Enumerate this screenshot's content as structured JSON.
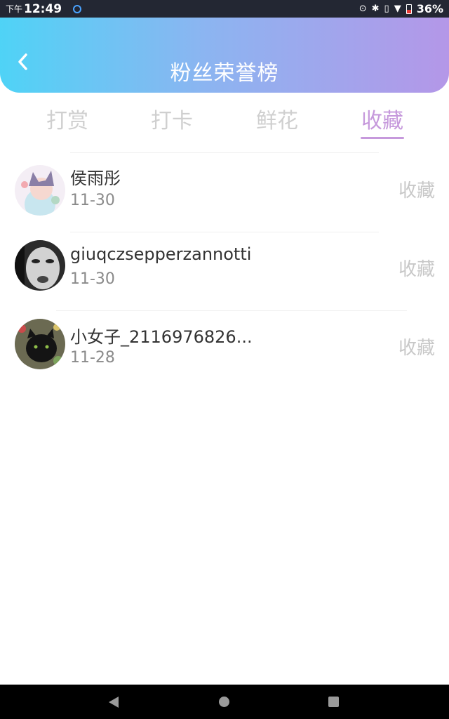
{
  "status_bar": {
    "ampm": "下午",
    "time": "12:49",
    "battery_percent": "36%"
  },
  "header": {
    "title": "粉丝荣誉榜"
  },
  "tabs": [
    {
      "label": "打赏",
      "active": false
    },
    {
      "label": "打卡",
      "active": false
    },
    {
      "label": "鲜花",
      "active": false
    },
    {
      "label": "收藏",
      "active": true
    }
  ],
  "fans": [
    {
      "name": "侯雨彤",
      "date": "11-30",
      "action": "收藏"
    },
    {
      "name": "giuqczsepperzannotti",
      "date": "11-30",
      "action": "收藏"
    },
    {
      "name": "小女子_2116976826...",
      "date": "11-28",
      "action": "收藏"
    }
  ],
  "colors": {
    "accent": "#c699dc",
    "header_gradient_start": "#4fd3f6",
    "header_gradient_end": "#b497e8"
  }
}
